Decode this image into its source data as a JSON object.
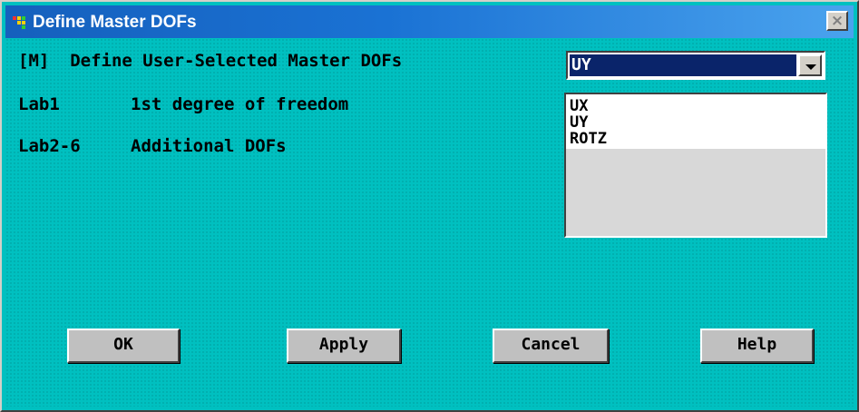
{
  "window": {
    "title": "Define Master DOFs",
    "close_glyph": "×"
  },
  "heading": "[M]  Define User-Selected Master DOFs",
  "lab1": {
    "name": "Lab1",
    "description": "1st degree of freedom",
    "selected": "UY"
  },
  "lab2": {
    "name": "Lab2-6",
    "description": "Additional DOFs",
    "options": [
      "UX",
      "UY",
      "ROTZ"
    ]
  },
  "buttons": {
    "ok": "OK",
    "apply": "Apply",
    "cancel": "Cancel",
    "help": "Help"
  },
  "colors": {
    "dialog_background": "#00c0c0",
    "title_bar": "#1560bd",
    "selection": "#0a246a"
  },
  "icons": {
    "app": "ansys-app-icon",
    "close": "close-icon",
    "dropdown": "chevron-down-icon"
  }
}
